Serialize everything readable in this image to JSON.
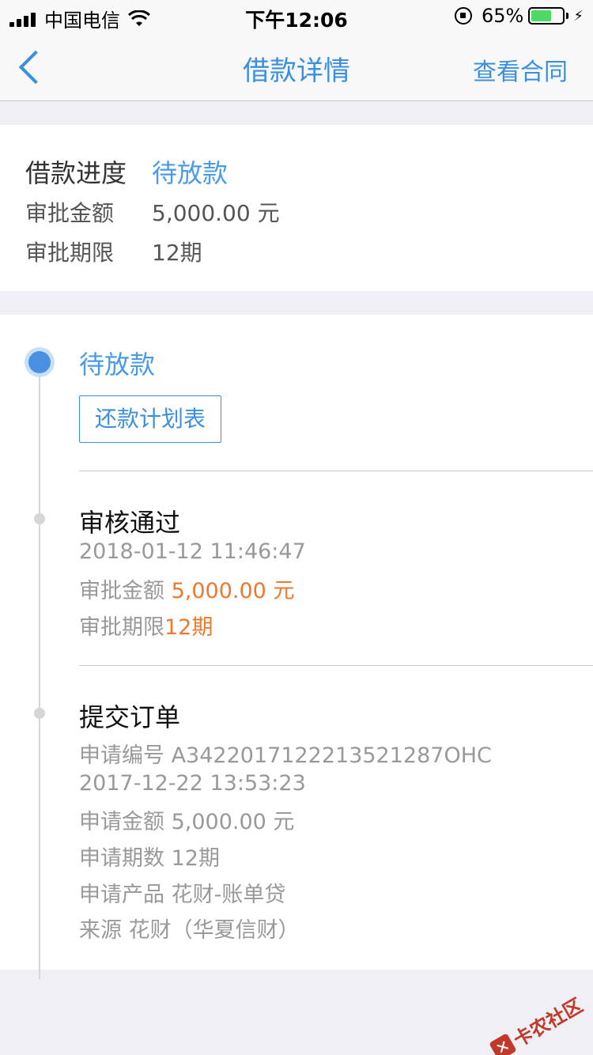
{
  "status_bar": {
    "carrier": "中国电信",
    "time": "下午12:06",
    "battery": "65%",
    "battery_level": 0.65
  },
  "nav": {
    "title": "借款详情",
    "action": "查看合同"
  },
  "summary": {
    "progress_label": "借款进度",
    "progress_value": "待放款",
    "amount_label": "审批金额",
    "amount_value": "5,000.00 元",
    "term_label": "审批期限",
    "term_value": "12期"
  },
  "timeline": {
    "active": {
      "title": "待放款",
      "button": "还款计划表"
    },
    "approved": {
      "title": "审核通过",
      "time": "2018-01-12 11:46:47",
      "amount_label": "审批金额",
      "amount_value": "5,000.00 元",
      "term_label": "审批期限",
      "term_value": "12期"
    },
    "submitted": {
      "title": "提交订单",
      "order_no": "申请编号 A3422017122213521287OHC",
      "time": "2017-12-22 13:53:23",
      "amount": "申请金额 5,000.00 元",
      "periods": "申请期数 12期",
      "product": "申请产品 花财-账单贷",
      "source": "来源 花财（华夏信财）"
    }
  },
  "watermark": "卡农社区",
  "colors": {
    "accent": "#3b8fe0",
    "highlight": "#f0782d"
  }
}
